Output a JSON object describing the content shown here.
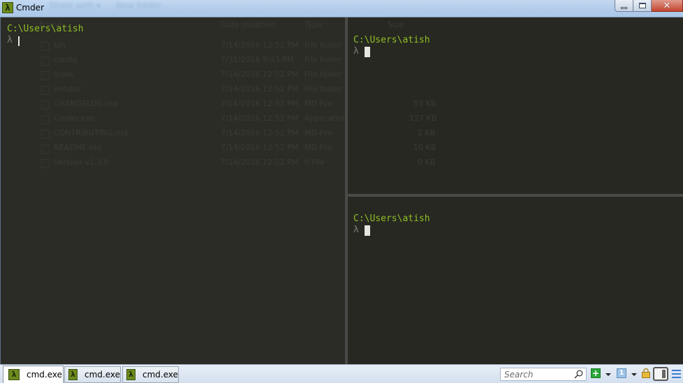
{
  "window": {
    "title": "Cmder",
    "app_icon": "lambda-icon",
    "controls": {
      "minimize": "minimize-icon",
      "maximize": "maximize-icon",
      "close": "✕"
    },
    "background_explorer_toolbar": [
      "Share with ▾",
      "New folder"
    ]
  },
  "panes": [
    {
      "id": "left",
      "path": "C:\\Users\\atish",
      "prompt": "λ",
      "cursor": "bar"
    },
    {
      "id": "top-right",
      "path": "C:\\Users\\atish",
      "prompt": "λ",
      "cursor": "block"
    },
    {
      "id": "bottom-right",
      "path": "C:\\Users\\atish",
      "prompt": "λ",
      "cursor": "block"
    }
  ],
  "background_explorer": {
    "columns": [
      "Name",
      "Date modified",
      "Type",
      "Size"
    ],
    "rows": [
      {
        "name": "bin",
        "date": "7/14/2016 12:52 PM",
        "type": "File folder",
        "size": ""
      },
      {
        "name": "config",
        "date": "7/31/2016 9:43 PM",
        "type": "File folder",
        "size": ""
      },
      {
        "name": "icons",
        "date": "7/14/2016 12:52 PM",
        "type": "File folder",
        "size": ""
      },
      {
        "name": "vendor",
        "date": "7/14/2016 12:52 PM",
        "type": "File folder",
        "size": ""
      },
      {
        "name": "CHANGELOG.md",
        "date": "7/14/2016 12:52 PM",
        "type": "MD File",
        "size": "53 KB"
      },
      {
        "name": "Cmder.exe",
        "date": "7/14/2016 12:52 PM",
        "type": "Application",
        "size": "127 KB"
      },
      {
        "name": "CONTRIBUTING.md",
        "date": "7/14/2016 12:52 PM",
        "type": "MD File",
        "size": "2 KB"
      },
      {
        "name": "README.md",
        "date": "7/14/2016 12:52 PM",
        "type": "MD File",
        "size": "10 KB"
      },
      {
        "name": "Version v1.3.0",
        "date": "7/14/2016 12:52 PM",
        "type": "0 File",
        "size": "0 KB"
      }
    ]
  },
  "tabs": [
    {
      "label": "cmd.exe",
      "icon": "λ",
      "active": true
    },
    {
      "label": "cmd.exe",
      "icon": "λ",
      "active": false
    },
    {
      "label": "cmd.exe",
      "icon": "λ",
      "active": false
    }
  ],
  "toolbar": {
    "search_placeholder": "Search",
    "new_console": "+",
    "console_number": "1"
  },
  "colors": {
    "prompt_path": "#8fbf24",
    "terminal_bg": "#272822",
    "app_icon_green": "#6d8c1e"
  }
}
